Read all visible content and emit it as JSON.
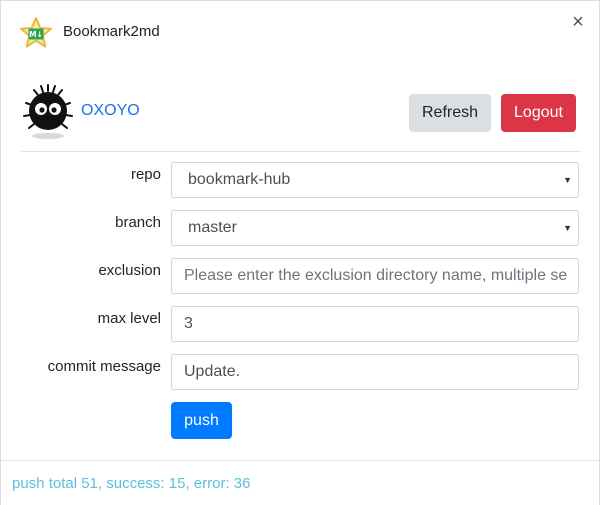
{
  "window": {
    "title": "Bookmark2md",
    "close_glyph": "×",
    "app_icon": "star-markdown-icon",
    "app_icon_text": "M↓"
  },
  "user": {
    "name": "OXOYO",
    "avatar_icon": "soot-sprite-avatar"
  },
  "actions": {
    "refresh_label": "Refresh",
    "logout_label": "Logout"
  },
  "form": {
    "repo": {
      "label": "repo",
      "value": "bookmark-hub"
    },
    "branch": {
      "label": "branch",
      "value": "master"
    },
    "exclusion": {
      "label": "exclusion",
      "value": "",
      "placeholder": "Please enter the exclusion directory name, multiple se"
    },
    "max_level": {
      "label": "max level",
      "value": "3"
    },
    "commit_message": {
      "label": "commit message",
      "value": "Update."
    },
    "push_label": "push"
  },
  "status": {
    "text": "push total 51, success: 15, error: 36"
  },
  "colors": {
    "link": "#1a73e8",
    "danger": "#dc3545",
    "primary": "#007bff",
    "info": "#5bc0de",
    "secondary": "#dcdfe2"
  }
}
